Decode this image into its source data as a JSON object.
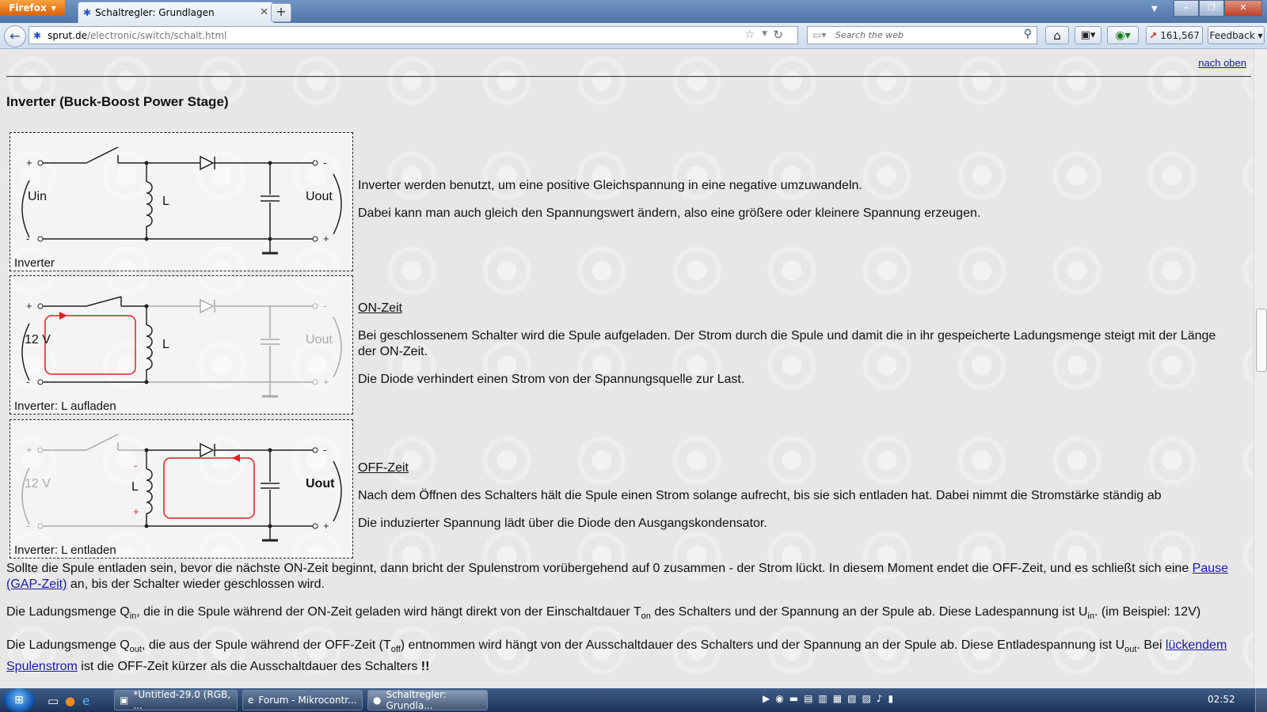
{
  "browser": {
    "menu_label": "Firefox",
    "tab_title": "Schaltregler: Grundlagen",
    "url_domain": "sprut.de",
    "url_path": "/electronic/switch/schalt.html",
    "search_placeholder": "Search the web",
    "counter": "161,567",
    "feedback_label": "Feedback"
  },
  "page": {
    "top_link": "nach oben",
    "section_title": "Inverter (Buck-Boost Power Stage)",
    "diagram1": {
      "caption": "Inverter",
      "uin": "Uin",
      "uout": "Uout",
      "l": "L"
    },
    "diagram2": {
      "caption": "Inverter: L aufladen",
      "uin": "12 V",
      "uout": "Uout",
      "l": "L"
    },
    "diagram3": {
      "caption": "Inverter: L entladen",
      "uin": "12 V",
      "uout": "Uout",
      "l": "L"
    },
    "intro1": "Inverter werden benutzt, um eine positive Gleichspannung in eine negative umzuwandeln.",
    "intro2": "Dabei kann man auch gleich den Spannungswert ändern, also eine größere oder kleinere Spannung erzeugen.",
    "on_heading": "ON-Zeit",
    "on_text1": "Bei geschlossenem Schalter wird die Spule aufgeladen. Der Strom durch die Spule und damit die in ihr gespeicherte Ladungsmenge steigt mit der Länge der ON-Zeit.",
    "on_text2": "Die Diode verhindert einen Strom von der Spannungsquelle zur Last.",
    "off_heading": "OFF-Zeit",
    "off_text1": "Nach dem Öffnen des Schalters hält die Spule einen Strom solange aufrecht, bis sie sich entladen hat. Dabei nimmt die Stromstärke ständig ab",
    "off_text2": "Die induzierter Spannung lädt über die Diode den Ausgangskondensator.",
    "para1_text": "Sollte die Spule entladen sein, bevor die nächste ON-Zeit beginnt, dann bricht der Spulenstrom vorübergehend auf 0 zusammen - der Strom lückt. In diesem Moment endet die OFF-Zeit, und es schließt sich eine ",
    "para1_link": "Pause (GAP-Zeit)",
    "para1_tail": " an, bis der Schalter wieder geschlossen wird.",
    "para2_a": "Die Ladungsmenge Q",
    "para2_sub1": "in",
    "para2_b": ", die in die Spule während der ON-Zeit geladen wird hängt direkt von der Einschaltdauer T",
    "para2_sub2": "on",
    "para2_c": " des Schalters und der Spannung an der Spule ab. Diese Ladespannung ist  U",
    "para2_sub3": "in",
    "para2_d": ". (im Beispiel: 12V)",
    "para3_a": "Die Ladungsmenge Q",
    "para3_sub1": "out",
    "para3_b": ", die aus der Spule während der OFF-Zeit  (T",
    "para3_sub2": "off",
    "para3_c": ") entnommen wird hängt  von der Ausschaltdauer des Schalters und der Spannung an der Spule ab. Diese Entladespannung ist U",
    "para3_sub3": "out",
    "para3_d": ". Bei ",
    "para3_link": "lückendem Spulenstrom",
    "para3_e": " ist die OFF-Zeit kürzer als die Ausschaltdauer des Schalters ",
    "para3_bang": "!!"
  },
  "taskbar": {
    "task1": "*Untitled-29.0 (RGB, ...",
    "task2": "Forum - Mikrocontr...",
    "task3": "Schaltregler: Grundla...",
    "clock": "02:52"
  },
  "colors": {
    "current_path": "#e02020",
    "link": "#1a1aa6",
    "inactive": "#aaaaaa"
  }
}
